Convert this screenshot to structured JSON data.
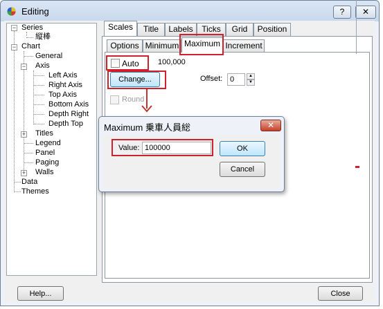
{
  "window": {
    "title": "Editing",
    "help_btn": "?",
    "close_btn": "✕"
  },
  "tree": {
    "items": [
      {
        "label": "Series"
      },
      {
        "label": "縦棒"
      },
      {
        "label": "Chart"
      },
      {
        "label": "General"
      },
      {
        "label": "Axis"
      },
      {
        "label": "Left Axis"
      },
      {
        "label": "Right Axis"
      },
      {
        "label": "Top Axis"
      },
      {
        "label": "Bottom Axis"
      },
      {
        "label": "Depth Right"
      },
      {
        "label": "Depth Top"
      },
      {
        "label": "Titles"
      },
      {
        "label": "Legend"
      },
      {
        "label": "Panel"
      },
      {
        "label": "Paging"
      },
      {
        "label": "Walls"
      },
      {
        "label": "Data"
      },
      {
        "label": "Themes"
      }
    ]
  },
  "tabs_top": [
    {
      "label": "Scales"
    },
    {
      "label": "Title"
    },
    {
      "label": "Labels"
    },
    {
      "label": "Ticks"
    },
    {
      "label": "Grid"
    },
    {
      "label": "Position"
    }
  ],
  "tabs_sub": [
    {
      "label": "Options"
    },
    {
      "label": "Minimum"
    },
    {
      "label": "Maximum"
    },
    {
      "label": "Increment"
    }
  ],
  "scale": {
    "auto_label": "Auto",
    "auto_checked": false,
    "max_value": "100,000",
    "change_btn": "Change...",
    "offset_label": "Offset:",
    "offset_value": "0",
    "round_label": "Round",
    "round_checked": false
  },
  "popup": {
    "title": "Maximum 乗車人員総",
    "close": "✕",
    "value_label": "Value:",
    "value": "100000",
    "ok": "OK",
    "cancel": "Cancel"
  },
  "footer": {
    "help_btn": "Help...",
    "close_btn": "Close"
  },
  "colors": {
    "highlight": "#d0202c"
  }
}
